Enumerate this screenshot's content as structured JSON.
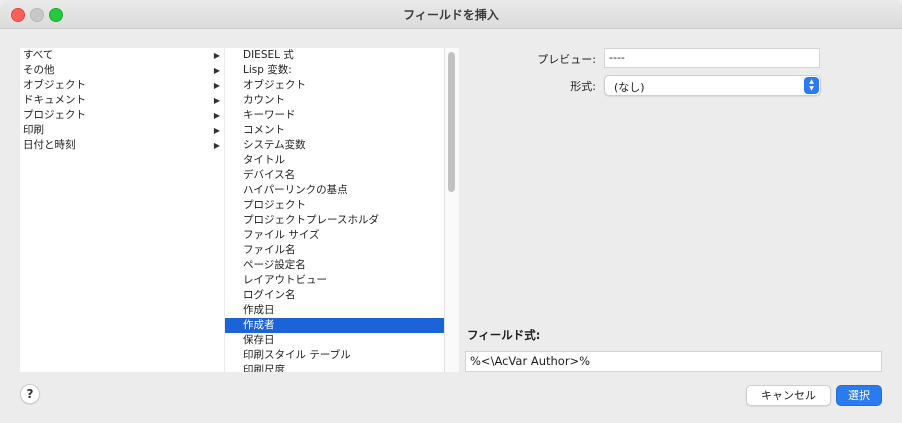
{
  "window": {
    "title": "フィールドを挿入"
  },
  "categories": [
    {
      "label": "すべて"
    },
    {
      "label": "その他"
    },
    {
      "label": "オブジェクト"
    },
    {
      "label": "ドキュメント"
    },
    {
      "label": "プロジェクト"
    },
    {
      "label": "印刷"
    },
    {
      "label": "日付と時刻"
    }
  ],
  "category_arrow": "▶",
  "fields": [
    "DIESEL 式",
    "Lisp 変数:",
    "オブジェクト",
    "カウント",
    "キーワード",
    "コメント",
    "システム変数",
    "タイトル",
    "デバイス名",
    "ハイパーリンクの基点",
    "プロジェクト",
    "プロジェクトプレースホルダ",
    "ファイル サイズ",
    "ファイル名",
    "ページ設定名",
    "レイアウトビュー",
    "ログイン名",
    "作成日",
    "作成者",
    "保存日",
    "印刷スタイル テーブル",
    "印刷尺度"
  ],
  "selected_field_index": 18,
  "preview": {
    "label": "プレビュー:",
    "value": "----"
  },
  "format": {
    "label": "形式:",
    "value": "(なし)"
  },
  "field_expression": {
    "label": "フィールド式:",
    "value": "%<\\AcVar Author>%"
  },
  "buttons": {
    "help": "?",
    "cancel": "キャンセル",
    "ok": "選択"
  },
  "colors": {
    "accent": "#2a7bef",
    "selection": "#1a63d8"
  }
}
